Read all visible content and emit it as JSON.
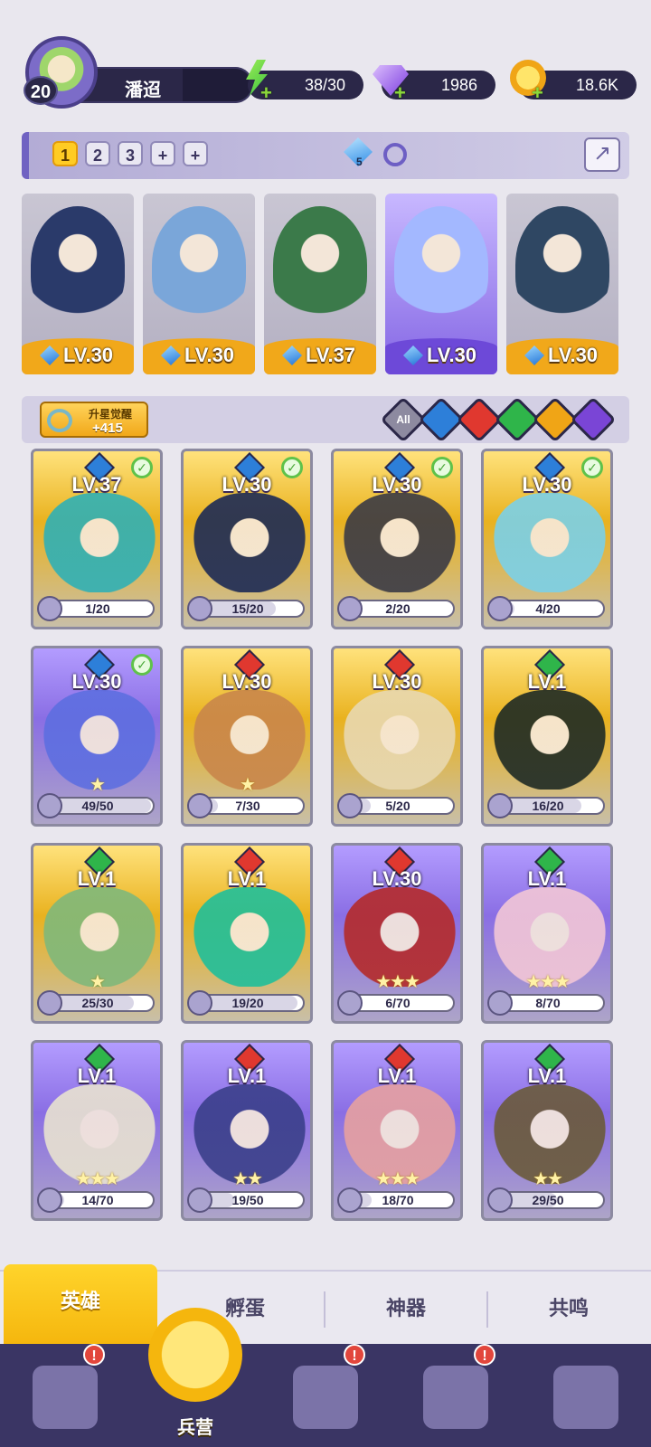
{
  "player": {
    "name": "潘迢",
    "level": "20"
  },
  "resources": [
    {
      "type": "energy",
      "value": "38/30",
      "icon": "lightning-icon"
    },
    {
      "type": "gems",
      "value": "1986",
      "icon": "gem-icon"
    },
    {
      "type": "coins",
      "value": "18.6K",
      "icon": "coin-icon"
    }
  ],
  "team_bar": {
    "tabs": [
      "1",
      "2",
      "3",
      "+",
      "+"
    ],
    "active_tab": "1",
    "mana_count": "5"
  },
  "team": [
    {
      "level": "LV.30",
      "style": "gray",
      "accent": "#2a3a6a"
    },
    {
      "level": "LV.30",
      "style": "gray",
      "accent": "#7aa6d9"
    },
    {
      "level": "LV.37",
      "style": "gray",
      "accent": "#3b7a4a"
    },
    {
      "level": "LV.30",
      "style": "purple",
      "accent": "#a3b8ff"
    },
    {
      "level": "LV.30",
      "style": "gray",
      "accent": "#2f4763"
    }
  ],
  "awaken": {
    "title": "升星觉醒",
    "value": "+415"
  },
  "filters": [
    {
      "label": "All",
      "color": "#8d8aa0"
    },
    {
      "label": "",
      "color": "#2d7fd9"
    },
    {
      "label": "",
      "color": "#e0382f"
    },
    {
      "label": "",
      "color": "#2fb54a"
    },
    {
      "label": "",
      "color": "#f0a516"
    },
    {
      "label": "",
      "color": "#7a45d6"
    }
  ],
  "heroes": [
    {
      "level": "LV.37",
      "element": "#2d7fd9",
      "frag": "1/20",
      "progress": 0.05,
      "check": true,
      "stars": "",
      "frame": "gold",
      "accent": "#2fb0b5"
    },
    {
      "level": "LV.30",
      "element": "#2d7fd9",
      "frag": "15/20",
      "progress": 0.75,
      "check": true,
      "stars": "",
      "frame": "gold",
      "accent": "#1c2a55"
    },
    {
      "level": "LV.30",
      "element": "#2d7fd9",
      "frag": "2/20",
      "progress": 0.1,
      "check": true,
      "stars": "",
      "frame": "gold",
      "accent": "#3a3a44"
    },
    {
      "level": "LV.30",
      "element": "#2d7fd9",
      "frag": "4/20",
      "progress": 0.2,
      "check": true,
      "stars": "",
      "frame": "gold",
      "accent": "#7ad0e8"
    },
    {
      "level": "LV.30",
      "element": "#2d7fd9",
      "frag": "49/50",
      "progress": 0.98,
      "check": true,
      "stars": "★",
      "frame": "purple",
      "accent": "#5d6ee0"
    },
    {
      "level": "LV.30",
      "element": "#e0382f",
      "frag": "7/30",
      "progress": 0.23,
      "check": false,
      "stars": "★",
      "frame": "gold",
      "accent": "#c9864a"
    },
    {
      "level": "LV.30",
      "element": "#e0382f",
      "frag": "5/20",
      "progress": 0.25,
      "check": false,
      "stars": "",
      "frame": "gold",
      "accent": "#e8d8b0"
    },
    {
      "level": "LV.1",
      "element": "#2fb54a",
      "frag": "16/20",
      "progress": 0.8,
      "check": false,
      "stars": "",
      "frame": "gold",
      "accent": "#1e2a24"
    },
    {
      "level": "LV.1",
      "element": "#2fb54a",
      "frag": "25/30",
      "progress": 0.83,
      "check": false,
      "stars": "★",
      "frame": "gold",
      "accent": "#7fb87a"
    },
    {
      "level": "LV.1",
      "element": "#e0382f",
      "frag": "19/20",
      "progress": 0.95,
      "check": false,
      "stars": "",
      "frame": "gold",
      "accent": "#1fbf9a"
    },
    {
      "level": "LV.30",
      "element": "#e0382f",
      "frag": "6/70",
      "progress": 0.09,
      "check": false,
      "stars": "★★★",
      "frame": "purple",
      "accent": "#b42a2a"
    },
    {
      "level": "LV.1",
      "element": "#2fb54a",
      "frag": "8/70",
      "progress": 0.11,
      "check": false,
      "stars": "★★★",
      "frame": "purple",
      "accent": "#f2c6d6"
    },
    {
      "level": "LV.1",
      "element": "#2fb54a",
      "frag": "14/70",
      "progress": 0.2,
      "check": false,
      "stars": "★★★",
      "frame": "purple",
      "accent": "#e8e2d0"
    },
    {
      "level": "LV.1",
      "element": "#e0382f",
      "frag": "19/50",
      "progress": 0.38,
      "check": false,
      "stars": "★★",
      "frame": "purple",
      "accent": "#3a3f8a"
    },
    {
      "level": "LV.1",
      "element": "#e0382f",
      "frag": "18/70",
      "progress": 0.26,
      "check": false,
      "stars": "★★★",
      "frame": "purple",
      "accent": "#e6a0a0"
    },
    {
      "level": "LV.1",
      "element": "#2fb54a",
      "frag": "29/50",
      "progress": 0.58,
      "check": false,
      "stars": "★★",
      "frame": "purple",
      "accent": "#6a5a3a"
    }
  ],
  "sub_tabs": [
    "英雄",
    "孵蛋",
    "神器",
    "共鸣"
  ],
  "active_sub_tab": "英雄",
  "nav": [
    {
      "icon": "cards-icon",
      "label": "",
      "badge": "!"
    },
    {
      "icon": "barracks-icon",
      "label": "兵营",
      "badge": "",
      "active": true
    },
    {
      "icon": "map-icon",
      "label": "",
      "badge": "!"
    },
    {
      "icon": "castle-icon",
      "label": "",
      "badge": "!"
    },
    {
      "icon": "mushroom-icon",
      "label": "",
      "badge": ""
    }
  ]
}
